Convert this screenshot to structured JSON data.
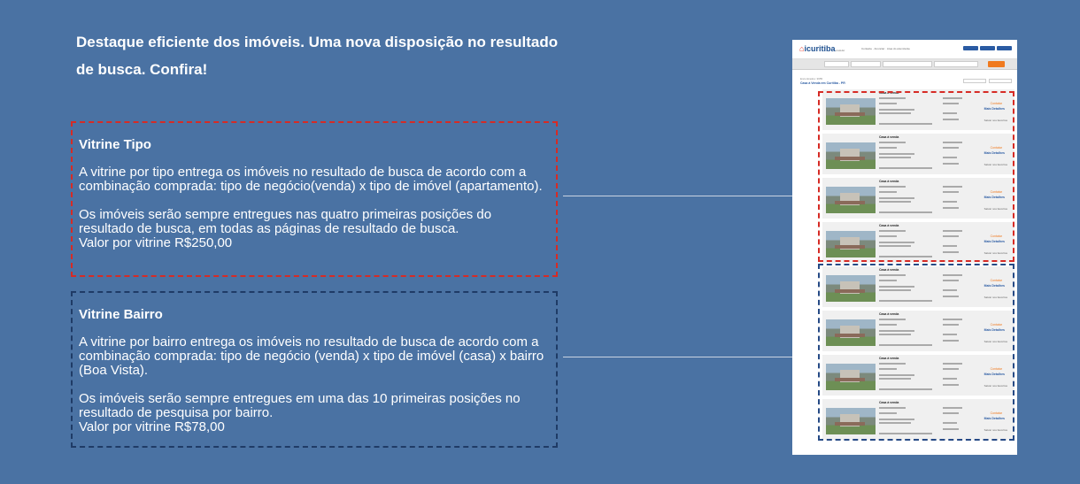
{
  "headline": "Destaque eficiente dos imóveis. Uma nova disposição no resultado de busca. Confira!",
  "colors": {
    "background": "#4a72a3",
    "tipo_border": "#d62b25",
    "bairro_border": "#1f3b66",
    "accent_orange": "#f07a1f",
    "brand_blue": "#2a5ba3"
  },
  "vitrine_tipo": {
    "title": "Vitrine Tipo",
    "paragraph1": "A vitrine por tipo entrega os imóveis no resultado de busca de acordo com a combinação comprada: tipo de negócio(venda) x tipo de imóvel (apartamento).",
    "paragraph2": "Os imóveis serão sempre entregues nas quatro primeiras posições do resultado de busca, em todas as páginas de resultado de busca.",
    "price": "Valor por vitrine R$250,00"
  },
  "vitrine_bairro": {
    "title": "Vitrine Bairro",
    "paragraph1": "A vitrine por bairro entrega os imóveis no resultado de busca de acordo com a combinação comprada: tipo de negócio (venda) x tipo de imóvel (casa) x bairro (Boa Vista).",
    "paragraph2": "Os imóveis serão sempre entregues em uma das 10 primeiras posições no resultado de pesquisa por bairro.",
    "price": "Valor por vitrine R$78,00"
  },
  "mockup": {
    "logo_main": "icuritiba",
    "logo_suffix": ".com.br",
    "nav": "Contacte · Anunciar · Area do anunciante",
    "breadcrumb": "Encontrados: 3955",
    "results_title": "Casa à Venda em Curitiba - PR",
    "cards": [
      {
        "title": "Casa à venda",
        "contact": "Contatar",
        "more": "Mais Detalhes",
        "fav": "Salvar nos favoritos"
      },
      {
        "title": "Casa à venda",
        "contact": "Contatar",
        "more": "Mais Detalhes",
        "fav": "Salvar nos favoritos"
      },
      {
        "title": "Casa à venda",
        "contact": "Contatar",
        "more": "Mais Detalhes",
        "fav": "Salvar nos favoritos"
      },
      {
        "title": "Casa à venda",
        "contact": "Contatar",
        "more": "Mais Detalhes",
        "fav": "Salvar nos favoritos"
      },
      {
        "title": "Casa à venda",
        "contact": "Contatar",
        "more": "Mais Detalhes",
        "fav": "Salvar nos favoritos"
      },
      {
        "title": "Casa à venda",
        "contact": "Contatar",
        "more": "Mais Detalhes",
        "fav": "Salvar nos favoritos"
      },
      {
        "title": "Casa à venda",
        "contact": "Contatar",
        "more": "Mais Detalhes",
        "fav": "Salvar nos favoritos"
      },
      {
        "title": "Casa à venda",
        "contact": "Contatar",
        "more": "Mais Detalhes",
        "fav": "Salvar nos favoritos"
      }
    ]
  }
}
